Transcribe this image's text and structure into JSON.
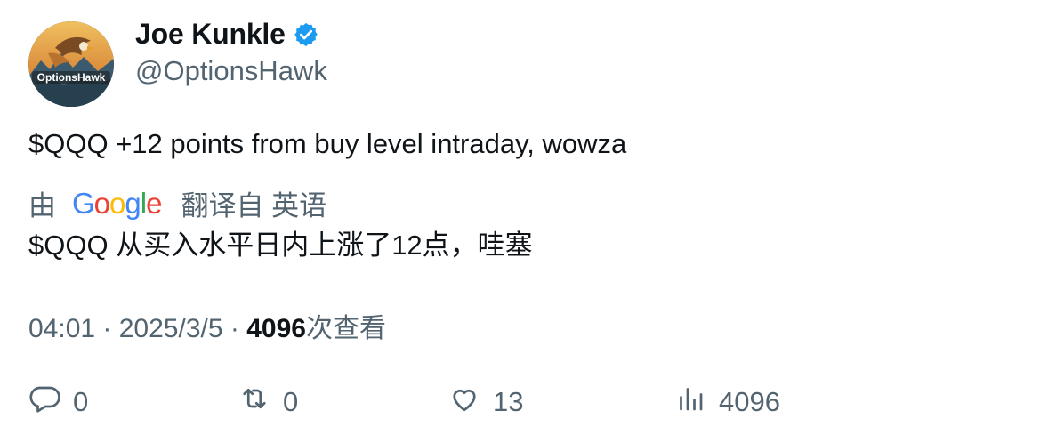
{
  "author": {
    "name": "Joe Kunkle",
    "handle": "@OptionsHawk",
    "verified": true,
    "avatar_text": "OptionsHawk",
    "verified_color": "#1d9bf0"
  },
  "tweet": {
    "text": "$QQQ +12 points from buy level intraday, wowza"
  },
  "translation": {
    "by_label": "由",
    "provider_letters": [
      "G",
      "o",
      "o",
      "g",
      "l",
      "e"
    ],
    "provider_colors": [
      "#4285F4",
      "#EA4335",
      "#FBBC05",
      "#4285F4",
      "#34A853",
      "#EA4335"
    ],
    "from_label": "翻译自 英语",
    "text": "$QQQ 从买入水平日内上涨了12点，哇塞"
  },
  "meta": {
    "time": "04:01",
    "sep1": " · ",
    "date": "2025/3/5",
    "sep2": " · ",
    "views_count": "4096",
    "views_label": "次查看"
  },
  "actions": {
    "reply": {
      "icon": "reply-icon",
      "count": "0"
    },
    "retweet": {
      "icon": "retweet-icon",
      "count": "0"
    },
    "like": {
      "icon": "heart-icon",
      "count": "13"
    },
    "views": {
      "icon": "views-icon",
      "count": "4096"
    }
  }
}
